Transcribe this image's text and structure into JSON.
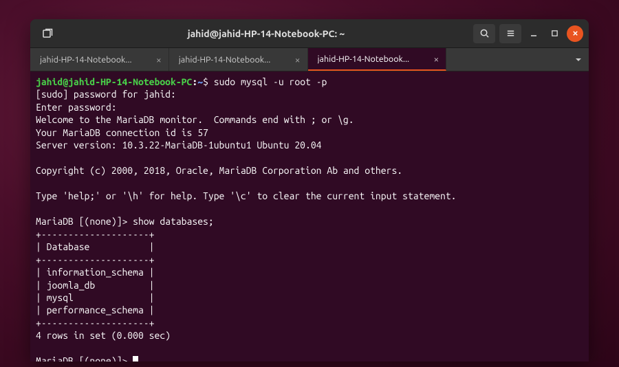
{
  "window": {
    "title": "jahid@jahid-HP-14-Notebook-PC: ~"
  },
  "tabs": [
    {
      "label": "jahid-HP-14-Notebook...",
      "active": false
    },
    {
      "label": "jahid-HP-14-Notebook...",
      "active": false
    },
    {
      "label": "jahid-HP-14-Notebook...",
      "active": true
    }
  ],
  "prompt": {
    "user": "jahid",
    "host": "jahid-HP-14-Notebook-PC",
    "path": "~",
    "sep_at": "@",
    "sep_colon": ":",
    "symbol": "$"
  },
  "terminal": {
    "cmd1": "sudo mysql -u root -p",
    "l2": "[sudo] password for jahid:",
    "l3": "Enter password:",
    "l4": "Welcome to the MariaDB monitor.  Commands end with ; or \\g.",
    "l5": "Your MariaDB connection id is 57",
    "l6": "Server version: 10.3.22-MariaDB-1ubuntu1 Ubuntu 20.04",
    "l7": "Copyright (c) 2000, 2018, Oracle, MariaDB Corporation Ab and others.",
    "l8": "Type 'help;' or '\\h' for help. Type '\\c' to clear the current input statement.",
    "mprompt": "MariaDB [(none)]>",
    "cmd2": "show databases;",
    "tbl_sep": "+--------------------+",
    "tbl_hdr": "| Database           |",
    "tbl_r1": "| information_schema |",
    "tbl_r2": "| joomla_db          |",
    "tbl_r3": "| mysql              |",
    "tbl_r4": "| performance_schema |",
    "result": "4 rows in set (0.000 sec)"
  }
}
